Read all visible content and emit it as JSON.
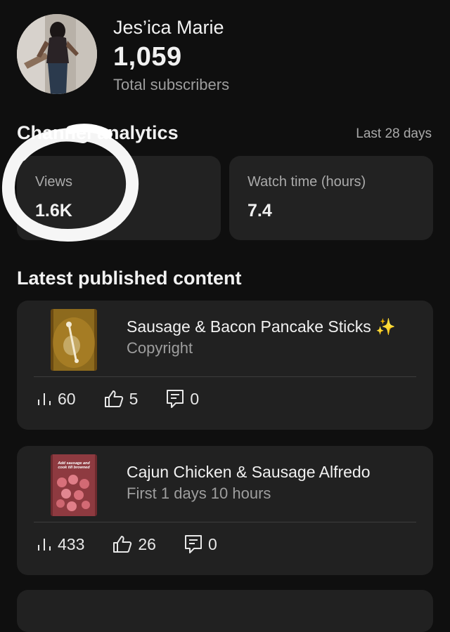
{
  "channel": {
    "name": "Jes’ica Marie",
    "subscriber_count": "1,059",
    "subscriber_label": "Total subscribers"
  },
  "analytics": {
    "title": "Channel analytics",
    "range": "Last 28 days",
    "stats": [
      {
        "label": "Views",
        "value": "1.6K"
      },
      {
        "label": "Watch time (hours)",
        "value": "7.4"
      }
    ]
  },
  "latest": {
    "title": "Latest published content",
    "videos": [
      {
        "title": "Sausage & Bacon Pancake Sticks ✨",
        "subtitle": "Copyright",
        "views": "60",
        "likes": "5",
        "comments": "0"
      },
      {
        "title": "Cajun Chicken & Sausage Alfredo",
        "subtitle": "First 1 days 10 hours",
        "views": "433",
        "likes": "26",
        "comments": "0",
        "thumb_caption": "Add sausage and cook till browned"
      }
    ]
  },
  "icons": {
    "views": "bar-chart-icon",
    "likes": "thumbs-up-icon",
    "comments": "comment-icon"
  },
  "colors": {
    "background": "#0f0f0f",
    "card": "#222222",
    "secondary_text": "#aaaaaa"
  }
}
